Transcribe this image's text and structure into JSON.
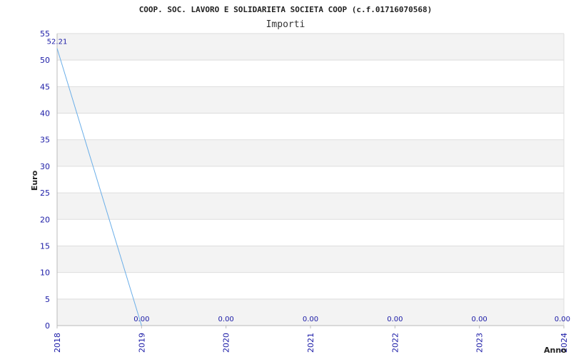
{
  "chart_data": {
    "type": "line",
    "title": "COOP. SOC. LAVORO E SOLIDARIETA SOCIETA COOP (c.f.01716070568)",
    "subtitle": "Importi",
    "xlabel": "Anno",
    "ylabel": "Euro",
    "x": [
      "2018",
      "2019",
      "2020",
      "2021",
      "2022",
      "2023",
      "2024"
    ],
    "series": [
      {
        "values": [
          52.21,
          0,
          0,
          0,
          0,
          0,
          0
        ],
        "data_labels": [
          "52.21",
          "0.00",
          "0.00",
          "0.00",
          "0.00",
          "0.00",
          "0.00"
        ],
        "plotted_points": 2,
        "color": "#6aaee8"
      }
    ],
    "yticks": [
      0,
      5,
      10,
      15,
      20,
      25,
      30,
      35,
      40,
      45,
      50,
      55
    ],
    "ylim": [
      0,
      55
    ],
    "grid": true,
    "band_color": "#f3f3f3",
    "grid_color": "#dddddd",
    "axis_color": "#bbbbbb",
    "tick_color": "#1a1aa6"
  }
}
